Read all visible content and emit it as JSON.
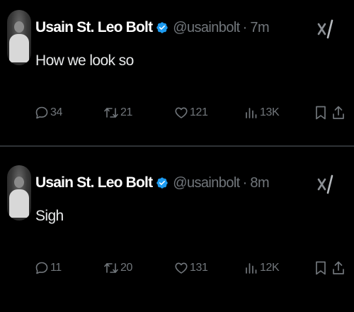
{
  "tweets": [
    {
      "author": {
        "name": "Usain St. Leo Bolt",
        "handle": "@usainbolt",
        "verified": true
      },
      "separator": "·",
      "time": "7m",
      "text": "How we look so",
      "stats": {
        "replies": "34",
        "retweets": "21",
        "likes": "121",
        "views": "13K"
      }
    },
    {
      "author": {
        "name": "Usain St. Leo Bolt",
        "handle": "@usainbolt",
        "verified": true
      },
      "separator": "·",
      "time": "8m",
      "text": "Sigh",
      "stats": {
        "replies": "11",
        "retweets": "20",
        "likes": "131",
        "views": "12K"
      }
    }
  ],
  "icons": {
    "verified": "verified-badge-icon",
    "grok": "grok-icon",
    "reply": "reply-icon",
    "retweet": "retweet-icon",
    "like": "heart-icon",
    "views": "views-icon",
    "bookmark": "bookmark-icon",
    "share": "share-icon"
  },
  "colors": {
    "background": "#000000",
    "primary_text": "#e7e9ea",
    "secondary_text": "#71767b",
    "verified": "#1d9bf0",
    "divider": "#2f3336"
  }
}
